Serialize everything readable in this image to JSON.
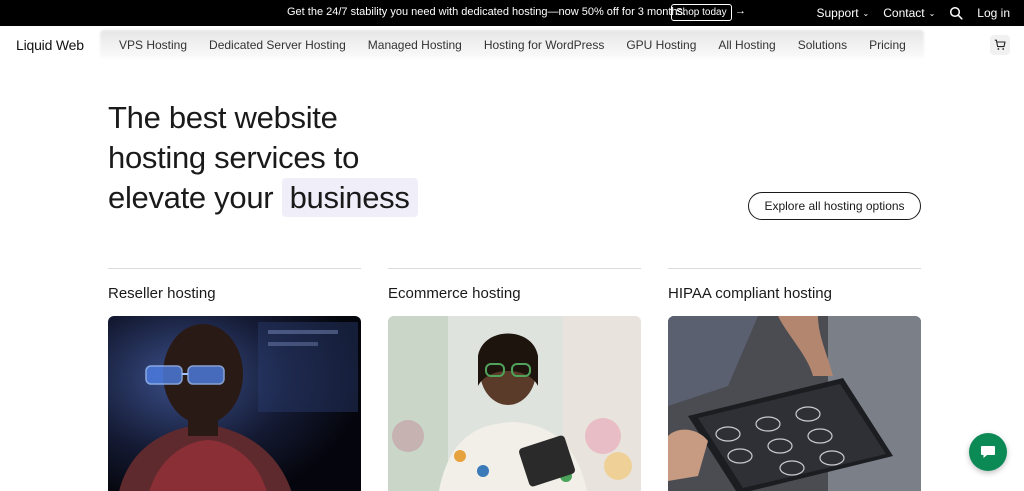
{
  "promo": {
    "message": "Get the 24/7 stability you need with dedicated hosting—now 50% off for 3 months.",
    "cta_label": "Shop today",
    "arrow": "→",
    "support_label": "Support",
    "contact_label": "Contact",
    "login_label": "Log in"
  },
  "nav": {
    "logo": "Liquid Web",
    "items": [
      {
        "label": "VPS Hosting"
      },
      {
        "label": "Dedicated Server Hosting"
      },
      {
        "label": "Managed Hosting"
      },
      {
        "label": "Hosting for WordPress"
      },
      {
        "label": "GPU Hosting"
      },
      {
        "label": "All Hosting"
      },
      {
        "label": "Solutions"
      },
      {
        "label": "Pricing"
      }
    ]
  },
  "hero": {
    "line1": "The best website",
    "line2": "hosting services to",
    "line3": "elevate your",
    "highlight": "business",
    "explore_label": "Explore all hosting options"
  },
  "cards": [
    {
      "title": "Reseller hosting",
      "image": "man-with-glasses-at-monitor"
    },
    {
      "title": "Ecommerce hosting",
      "image": "woman-with-tablet-in-shop"
    },
    {
      "title": "HIPAA compliant hosting",
      "image": "hands-on-tablet-with-scans"
    }
  ],
  "colors": {
    "promo_bg": "#000000",
    "highlight_bg": "#f0eef9",
    "chat_bg": "#0b8a56"
  },
  "icons": {
    "search": "search-icon",
    "cart": "cart-icon",
    "chat": "chat-icon"
  }
}
